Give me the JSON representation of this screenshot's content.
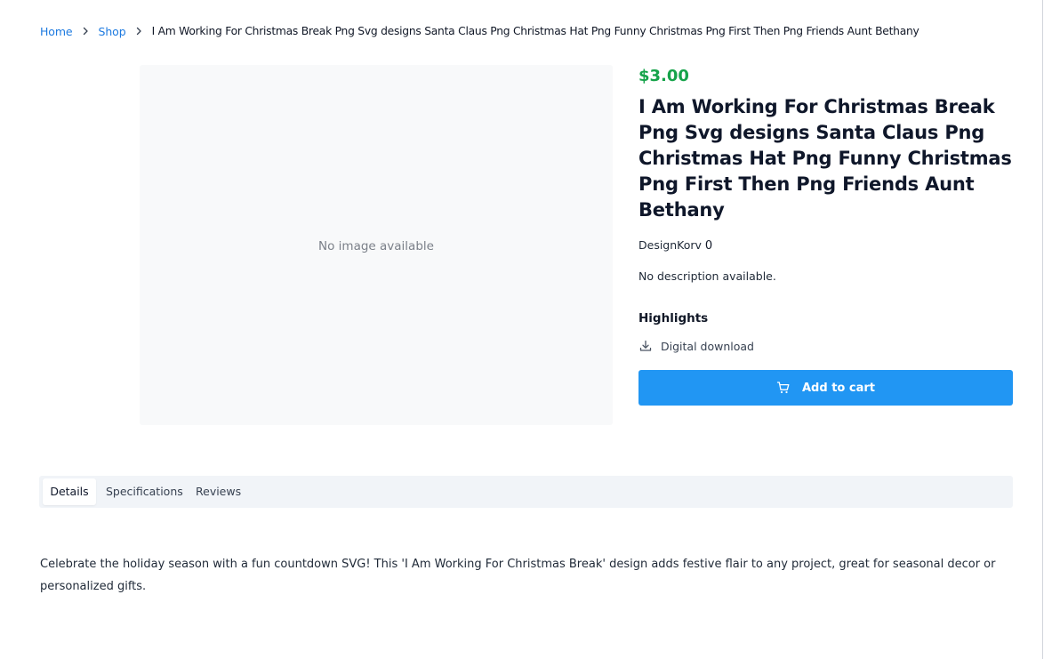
{
  "breadcrumb": {
    "home": "Home",
    "shop": "Shop",
    "current": "I Am Working For Christmas Break Png Svg designs Santa Claus Png Christmas Hat Png Funny Christmas Png First Then Png Friends Aunt Bethany"
  },
  "image": {
    "placeholder": "No image available"
  },
  "product": {
    "price": "$3.00",
    "title": "I Am Working For Christmas Break Png Svg designs Santa Claus Png Christmas Hat Png Funny Christmas Png First Then Png Friends Aunt Bethany",
    "vendor": "DesignKorv",
    "vendor_count": "0",
    "description": "No description available.",
    "highlights_title": "Highlights",
    "highlights": [
      {
        "icon": "download-icon",
        "label": "Digital download"
      }
    ],
    "add_to_cart_label": "Add to cart"
  },
  "tabs": {
    "details": "Details",
    "specifications": "Specifications",
    "reviews": "Reviews",
    "active": "Details"
  },
  "details_text": "Celebrate the holiday season with a fun countdown SVG! This 'I Am Working For Christmas Break' design adds festive flair to any project, great for seasonal decor or personalized gifts.",
  "colors": {
    "price": "#16a34a",
    "link": "#1d7ae0",
    "button": "#2196f3",
    "tabs_bg": "#f1f4f8",
    "image_bg": "#f8f9fa"
  }
}
